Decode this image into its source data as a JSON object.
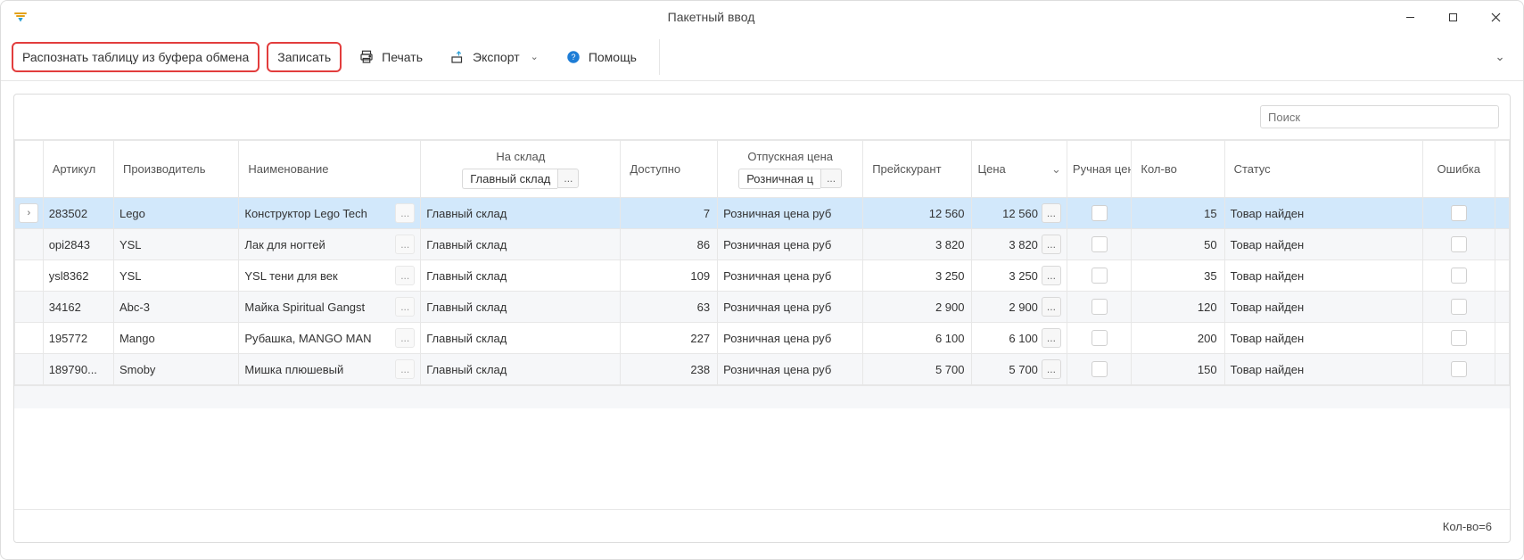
{
  "window": {
    "title": "Пакетный ввод"
  },
  "toolbar": {
    "recognize": "Распознать таблицу из буфера обмена",
    "save": "Записать",
    "print": "Печать",
    "export": "Экспорт",
    "help": "Помощь"
  },
  "search": {
    "placeholder": "Поиск"
  },
  "columns": {
    "article": "Артикул",
    "manufacturer": "Производитель",
    "name": "Наименование",
    "to_warehouse": "На склад",
    "to_warehouse_value": "Главный склад",
    "available": "Доступно",
    "release_price": "Отпускная цена",
    "release_price_value": "Розничная ц",
    "price_list": "Прейскурант",
    "price": "Цена",
    "manual_price": "Ручная цена",
    "qty": "Кол-во",
    "status": "Статус",
    "error": "Ошибка"
  },
  "rows": [
    {
      "article": "283502",
      "manufacturer": "Lego",
      "name": "Конструктор Lego Tech",
      "warehouse": "Главный склад",
      "available": "7",
      "release": "Розничная цена руб",
      "pricelist": "12 560",
      "price": "12 560",
      "qty": "15",
      "status": "Товар найден"
    },
    {
      "article": "opi2843",
      "manufacturer": "YSL",
      "name": "Лак для ногтей",
      "warehouse": "Главный склад",
      "available": "86",
      "release": "Розничная цена руб",
      "pricelist": "3 820",
      "price": "3 820",
      "qty": "50",
      "status": "Товар найден"
    },
    {
      "article": "ysl8362",
      "manufacturer": "YSL",
      "name": "YSL тени для век",
      "warehouse": "Главный склад",
      "available": "109",
      "release": "Розничная цена руб",
      "pricelist": "3 250",
      "price": "3 250",
      "qty": "35",
      "status": "Товар найден"
    },
    {
      "article": "34162",
      "manufacturer": "Abc-3",
      "name": "Майка Spiritual Gangst",
      "warehouse": "Главный склад",
      "available": "63",
      "release": "Розничная цена руб",
      "pricelist": "2 900",
      "price": "2 900",
      "qty": "120",
      "status": "Товар найден"
    },
    {
      "article": "195772",
      "manufacturer": "Mango",
      "name": "Рубашка, MANGO MAN",
      "warehouse": "Главный склад",
      "available": "227",
      "release": "Розничная цена руб",
      "pricelist": "6 100",
      "price": "6 100",
      "qty": "200",
      "status": "Товар найден"
    },
    {
      "article": "189790...",
      "manufacturer": "Smoby",
      "name": "Мишка плюшевый",
      "warehouse": "Главный склад",
      "available": "238",
      "release": "Розничная цена руб",
      "pricelist": "5 700",
      "price": "5 700",
      "qty": "150",
      "status": "Товар найден"
    }
  ],
  "footer": {
    "count": "Кол-во=6"
  },
  "icons": {
    "dots": "...",
    "chev_down": "⌄",
    "chev_right": "›"
  }
}
